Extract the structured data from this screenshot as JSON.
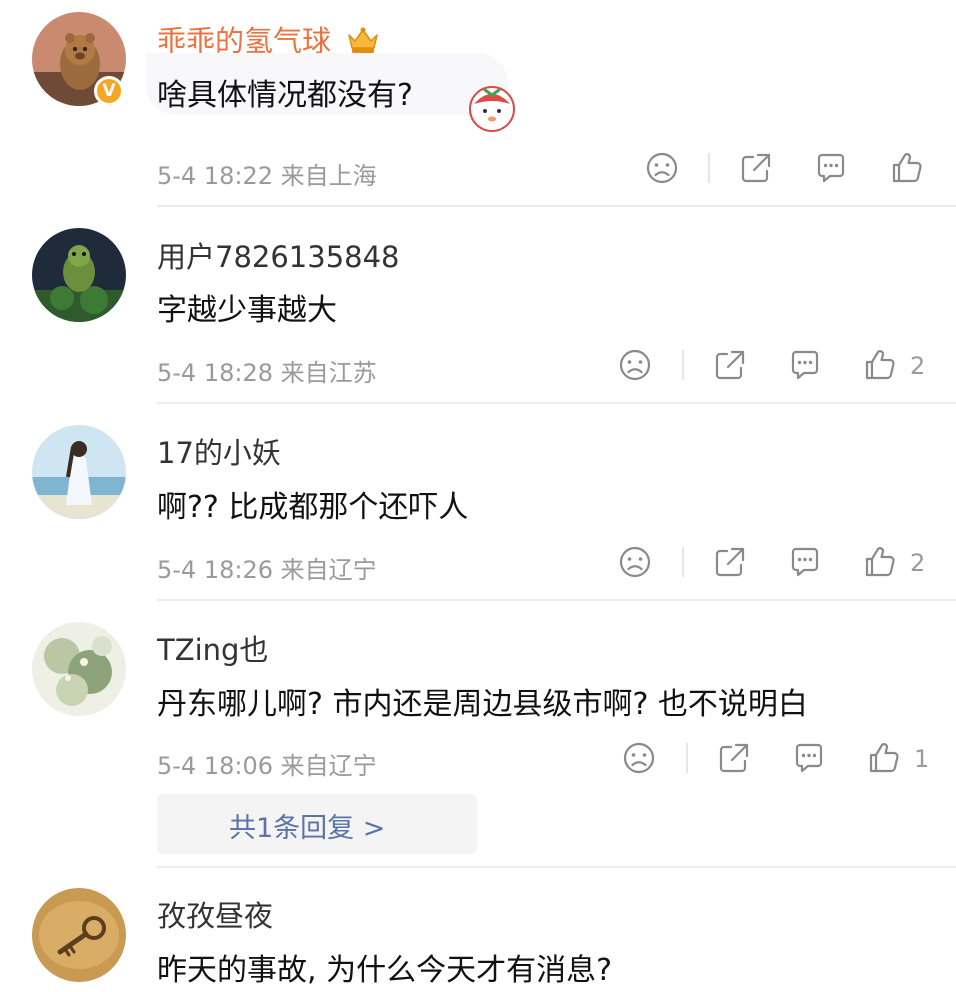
{
  "comments": [
    {
      "username": "乖乖的氢气球",
      "text": "啥具体情况都没有?",
      "time": "5-4 18:22",
      "location": "来自上海",
      "likes": "",
      "verified_badge": "V",
      "vip_icon": "crown-icon"
    },
    {
      "username": "用户7826135848",
      "text": "字越少事越大",
      "time": "5-4 18:28",
      "location": "来自江苏",
      "likes": "2"
    },
    {
      "username": "17的小妖",
      "text": "啊?? 比成都那个还吓人",
      "time": "5-4 18:26",
      "location": "来自辽宁",
      "likes": "2"
    },
    {
      "username": "TZing也",
      "text": "丹东哪儿啊? 市内还是周边县级市啊? 也不说明白",
      "time": "5-4 18:06",
      "location": "来自辽宁",
      "likes": "1",
      "replies_link": "共1条回复 >"
    },
    {
      "username": "孜孜昼夜",
      "text": "昨天的事故, 为什么今天才有消息?"
    }
  ],
  "icons": {
    "dislike": "sad-face-icon",
    "share": "share-icon",
    "comment": "comment-icon",
    "like": "thumbs-up-icon"
  },
  "colors": {
    "vip_name": "#eb7340",
    "link": "#5b73a8",
    "meta": "#9a9a9a",
    "verified": "#f5a623"
  }
}
